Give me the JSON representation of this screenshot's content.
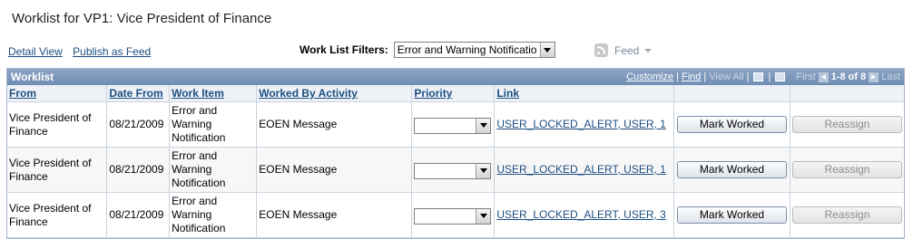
{
  "page": {
    "title": "Worklist for VP1: Vice President of Finance"
  },
  "top_links": {
    "detail_view": "Detail View",
    "publish_feed": "Publish as Feed"
  },
  "filters": {
    "label": "Work List Filters:",
    "selected": "Error and Warning Notificatio"
  },
  "feed": {
    "label": "Feed"
  },
  "grid": {
    "title": "Worklist",
    "nav": {
      "customize": "Customize",
      "find": "Find",
      "view_all": "View All",
      "first": "First",
      "range": "1-8 of 8",
      "last": "Last"
    },
    "columns": {
      "from": "From",
      "date_from": "Date From",
      "work_item": "Work Item",
      "worked_by": "Worked By Activity",
      "priority": "Priority",
      "link": "Link"
    },
    "rows": [
      {
        "from": "Vice President of Finance",
        "date": "08/21/2009",
        "work_item": "Error and Warning Notification",
        "worked_by": "EOEN Message",
        "priority": "",
        "link": "USER_LOCKED_ALERT, USER, 1",
        "mark_worked": "Mark Worked",
        "reassign": "Reassign"
      },
      {
        "from": "Vice President of Finance",
        "date": "08/21/2009",
        "work_item": "Error and Warning Notification",
        "worked_by": "EOEN Message",
        "priority": "",
        "link": "USER_LOCKED_ALERT, USER, 1",
        "mark_worked": "Mark Worked",
        "reassign": "Reassign"
      },
      {
        "from": "Vice President of Finance",
        "date": "08/21/2009",
        "work_item": "Error and Warning Notification",
        "worked_by": "EOEN Message",
        "priority": "",
        "link": "USER_LOCKED_ALERT, USER, 3",
        "mark_worked": "Mark Worked",
        "reassign": "Reassign"
      }
    ]
  },
  "colors": {
    "header_blue": "#7b96bb",
    "link_blue": "#1c4e80"
  }
}
